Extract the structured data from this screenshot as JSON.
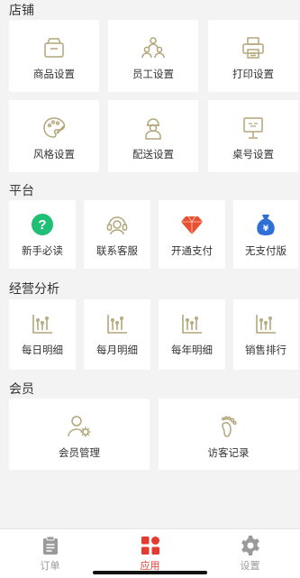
{
  "sections": {
    "store": "店铺",
    "platform": "平台",
    "analysis": "经营分析",
    "member": "会员"
  },
  "store_items": [
    {
      "label": "商品设置",
      "icon": "product-icon"
    },
    {
      "label": "员工设置",
      "icon": "staff-icon"
    },
    {
      "label": "打印设置",
      "icon": "printer-icon"
    },
    {
      "label": "风格设置",
      "icon": "palette-icon"
    },
    {
      "label": "配送设置",
      "icon": "courier-icon"
    },
    {
      "label": "桌号设置",
      "icon": "table-number-icon"
    }
  ],
  "platform_items": [
    {
      "label": "新手必读",
      "icon": "help-icon"
    },
    {
      "label": "联系客服",
      "icon": "headset-icon"
    },
    {
      "label": "开通支付",
      "icon": "diamond-icon"
    },
    {
      "label": "无支付版",
      "icon": "money-bag-icon"
    }
  ],
  "analysis_items": [
    {
      "label": "每日明细",
      "icon": "bar-chart-icon"
    },
    {
      "label": "每月明细",
      "icon": "bar-chart-icon"
    },
    {
      "label": "每年明细",
      "icon": "bar-chart-icon"
    },
    {
      "label": "销售排行",
      "icon": "bar-chart-icon"
    }
  ],
  "member_items": [
    {
      "label": "会员管理",
      "icon": "member-settings-icon"
    },
    {
      "label": "访客记录",
      "icon": "footprint-icon"
    }
  ],
  "tabs": [
    {
      "label": "订单",
      "icon": "clipboard-icon",
      "active": false
    },
    {
      "label": "应用",
      "icon": "apps-icon",
      "active": true
    },
    {
      "label": "设置",
      "icon": "gear-icon",
      "active": false
    }
  ],
  "colors": {
    "icon_gold": "#b3a67a",
    "accent": "#e53a2f",
    "help_green": "#1fbf76",
    "diamond_red": "#e8502f",
    "bag_blue": "#2f6fd6"
  }
}
